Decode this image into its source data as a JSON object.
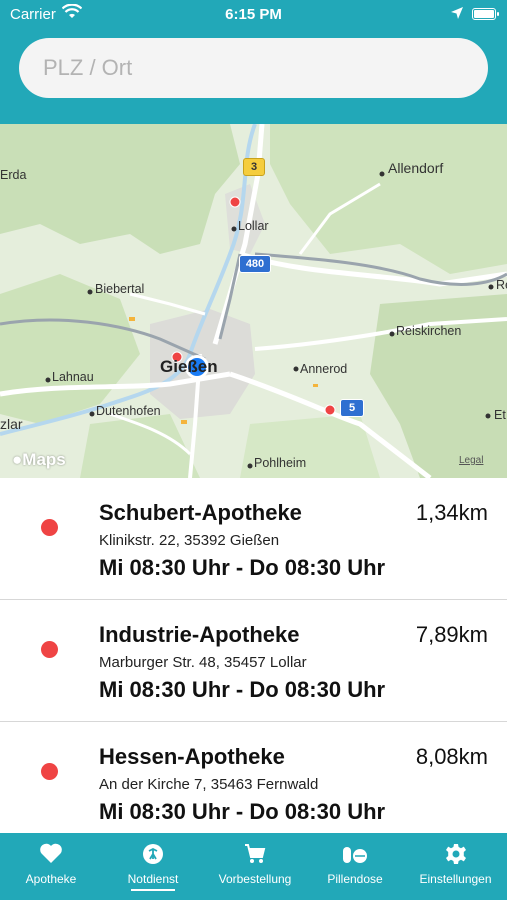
{
  "status_bar": {
    "carrier": "Carrier",
    "time": "6:15 PM"
  },
  "search": {
    "placeholder": "PLZ / Ort",
    "value": ""
  },
  "map": {
    "towns": {
      "erda": "Erda",
      "allendorf": "Allendorf",
      "lollar": "Lollar",
      "biebertal": "Biebertal",
      "reiskirchen": "Reiskirchen",
      "giessen": "Gießen",
      "annerod": "Annerod",
      "lahnau": "Lahnau",
      "dutenhofen": "Dutenhofen",
      "wetzlar_partial": "zlar",
      "pohlheim": "Pohlheim",
      "re_partial": "Re",
      "et_partial": "Et"
    },
    "road_shields": {
      "b3": "3",
      "a480": "480",
      "a5": "5"
    },
    "attribution": "Maps",
    "legal": "Legal"
  },
  "pharmacies": [
    {
      "name": "Schubert-Apotheke",
      "distance": "1,34km",
      "address": "Klinikstr. 22, 35392 Gießen",
      "hours": "Mi 08:30 Uhr - Do 08:30 Uhr"
    },
    {
      "name": "Industrie-Apotheke",
      "distance": "7,89km",
      "address": "Marburger Str. 48, 35457 Lollar",
      "hours": "Mi 08:30 Uhr - Do 08:30 Uhr"
    },
    {
      "name": "Hessen-Apotheke",
      "distance": "8,08km",
      "address": "An der Kirche 7, 35463 Fernwald",
      "hours": "Mi 08:30 Uhr - Do 08:30 Uhr"
    }
  ],
  "tabs": [
    {
      "label": "Apotheke",
      "icon": "heart-icon",
      "active": false
    },
    {
      "label": "Notdienst",
      "icon": "emergency-icon",
      "active": true
    },
    {
      "label": "Vorbestellung",
      "icon": "cart-icon",
      "active": false
    },
    {
      "label": "Pillendose",
      "icon": "pills-icon",
      "active": false
    },
    {
      "label": "Einstellungen",
      "icon": "gear-icon",
      "active": false
    }
  ],
  "colors": {
    "accent": "#22a8b8",
    "marker_red": "#ef4444",
    "user_location": "#1a7cf5"
  }
}
